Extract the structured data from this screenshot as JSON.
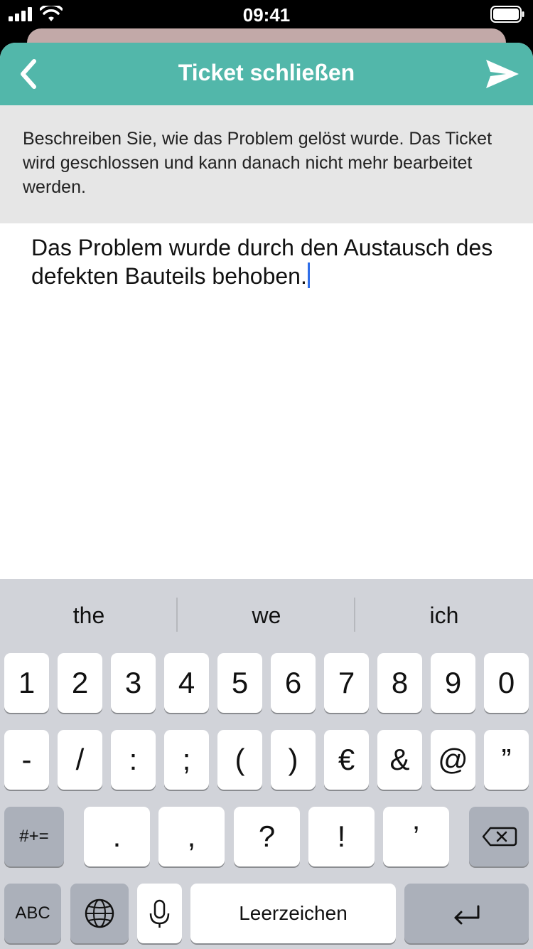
{
  "status_bar": {
    "time": "09:41"
  },
  "navbar": {
    "title": "Ticket schließen",
    "back_icon": "chevron-left-icon",
    "send_icon": "paper-plane-send-icon"
  },
  "info": {
    "text": "Beschreiben Sie, wie das Problem gelöst wurde. Das Ticket wird geschlossen und kann danach nicht mehr bearbeitet werden."
  },
  "editor": {
    "value": "Das Problem wurde durch den Austausch des defekten Bauteils behoben."
  },
  "keyboard": {
    "suggestions": [
      "the",
      "we",
      "ich"
    ],
    "row1": [
      "1",
      "2",
      "3",
      "4",
      "5",
      "6",
      "7",
      "8",
      "9",
      "0"
    ],
    "row2": [
      "-",
      "/",
      ":",
      ";",
      "(",
      ")",
      "€",
      "&",
      "@",
      "”"
    ],
    "row3": [
      ".",
      ",",
      "?",
      "!",
      "’"
    ],
    "symbols_label": "#+=",
    "abc_label": "ABC",
    "space_label": "Leerzeichen",
    "globe_icon": "globe-icon",
    "mic_icon": "microphone-icon",
    "delete_icon": "delete-backspace-icon",
    "return_icon": "return-icon"
  },
  "colors": {
    "accent": "#52b7aa",
    "caret": "#2f6ee8",
    "keyboard_bg": "#d1d3d9"
  }
}
